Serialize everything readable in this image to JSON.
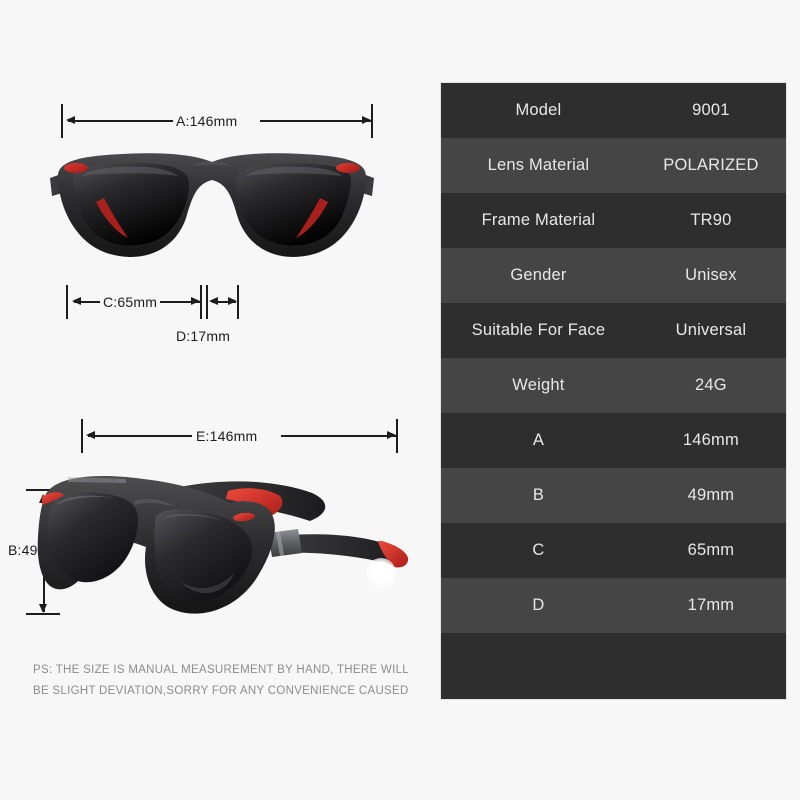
{
  "background_color": "#f7f7f7",
  "dimension_callouts": {
    "a": {
      "label": "A:146mm",
      "value": "146mm",
      "orientation": "horizontal",
      "view": "front"
    },
    "c": {
      "label": "C:65mm",
      "value": "65mm",
      "orientation": "horizontal",
      "view": "front"
    },
    "d": {
      "label": "D:17mm",
      "value": "17mm",
      "orientation": "horizontal",
      "view": "front"
    },
    "e": {
      "label": "E:146mm",
      "value": "146mm",
      "orientation": "horizontal",
      "view": "angled"
    },
    "b": {
      "label": "B:49mm",
      "value": "49mm",
      "orientation": "vertical",
      "view": "angled"
    }
  },
  "product_images": {
    "front_view_alt": "sunglasses front view black frame polarized lenses",
    "angled_view_alt": "sunglasses three quarter angled view with temple arms"
  },
  "disclaimer": {
    "line1": "PS: THE SIZE IS MANUAL MEASUREMENT BY HAND, THERE WILL",
    "line2": "BE SLIGHT DEVIATION,SORRY FOR ANY CONVENIENCE CAUSED"
  },
  "spec_table": {
    "row_color_dark": "#2e2e2e",
    "row_color_light": "#454545",
    "text_color": "#e8e8e8",
    "rows": [
      {
        "label": "Model",
        "value": "9001"
      },
      {
        "label": "Lens Material",
        "value": "POLARIZED"
      },
      {
        "label": "Frame Material",
        "value": "TR90"
      },
      {
        "label": "Gender",
        "value": "Unisex"
      },
      {
        "label": "Suitable For Face",
        "value": "Universal"
      },
      {
        "label": "Weight",
        "value": "24G"
      },
      {
        "label": "A",
        "value": "146mm"
      },
      {
        "label": "B",
        "value": "49mm"
      },
      {
        "label": "C",
        "value": "65mm"
      },
      {
        "label": "D",
        "value": "17mm"
      }
    ]
  }
}
